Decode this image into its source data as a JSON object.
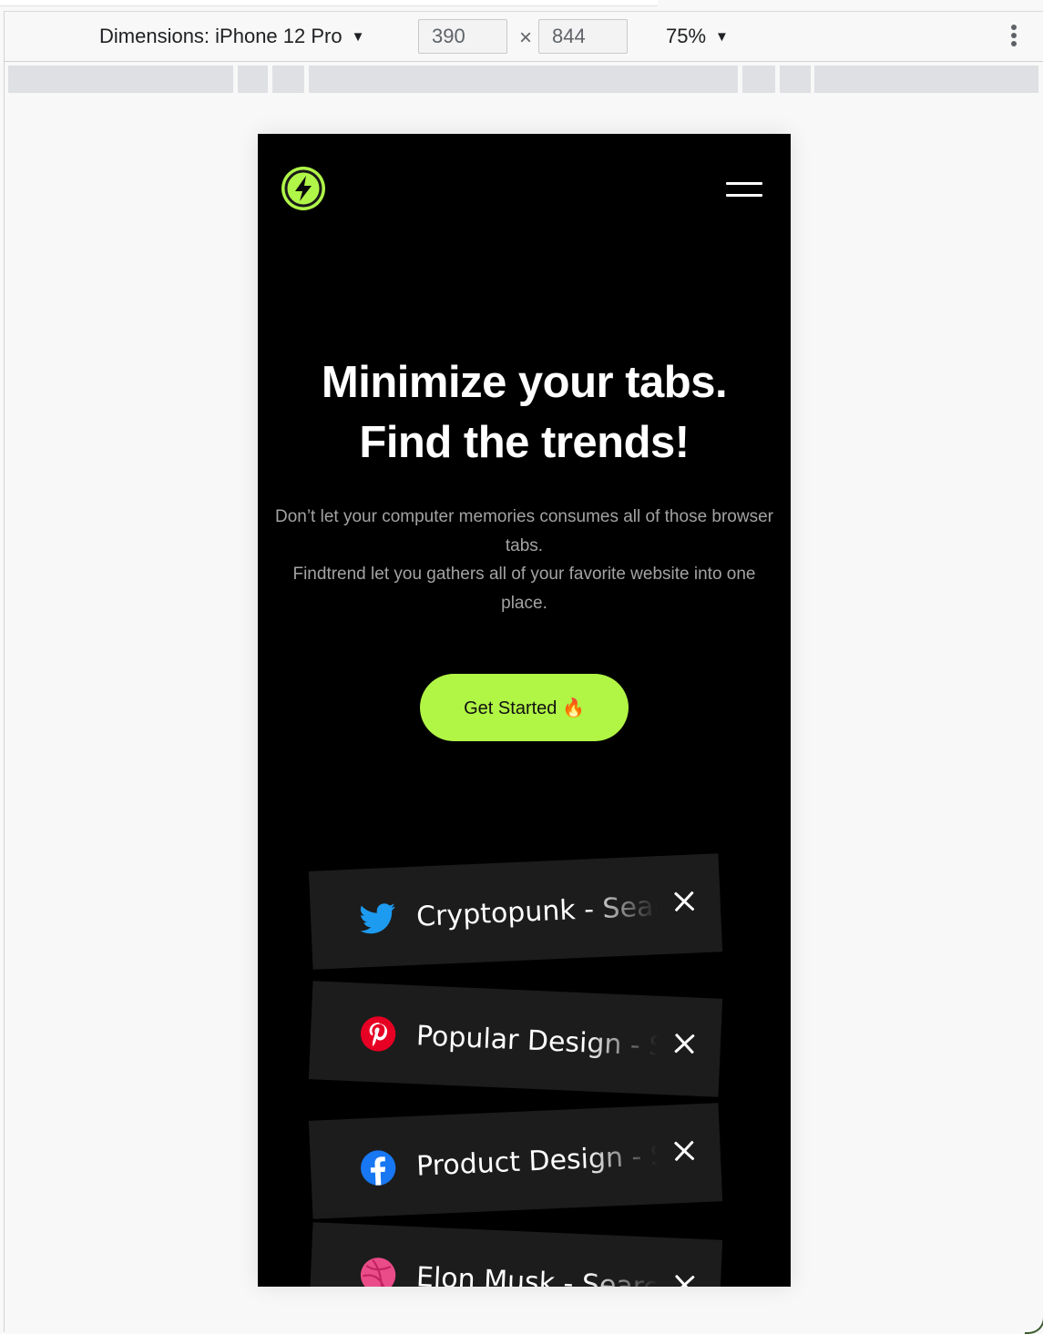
{
  "devtools": {
    "device_label": "Dimensions: iPhone 12 Pro",
    "width_value": "390",
    "height_value": "844",
    "times_glyph": "×",
    "zoom_label": "75%",
    "caret_glyph": "▼",
    "more_menu_icon": "vertical-ellipsis-icon"
  },
  "site": {
    "logo_icon": "lightning-bolt-icon",
    "menu_icon": "hamburger-menu-icon",
    "hero": {
      "title_line1": "Minimize your tabs.",
      "title_line2": "Find the trends!",
      "desc_line1": "Don’t let your computer memories consumes all of those browser tabs.",
      "desc_line2": "Findtrend let you gathers all of your favorite website into one place."
    },
    "cta_label": "Get Started 🔥",
    "tabs": [
      {
        "title": "Cryptopunk - Search",
        "icon": "twitter-icon"
      },
      {
        "title": "Popular Design - Search",
        "icon": "pinterest-icon"
      },
      {
        "title": "Product Design - Search",
        "icon": "facebook-icon"
      },
      {
        "title": "Elon Musk - Search",
        "icon": "dribbble-icon"
      }
    ]
  },
  "colors": {
    "accent": "#b1f545",
    "page_background": "#000000",
    "tab_background": "#1c1c1c",
    "body_text": "#a3a3a3"
  }
}
